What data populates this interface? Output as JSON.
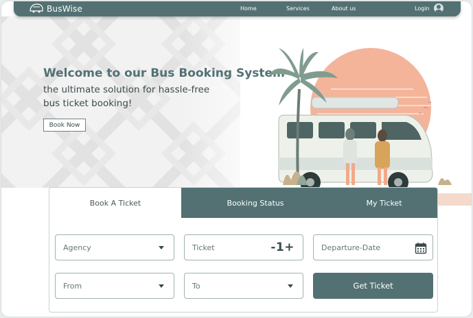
{
  "nav": {
    "brand": "BusWise",
    "links": [
      "Home",
      "Services",
      "About us"
    ],
    "login_label": "Login",
    "icons": {
      "logo": "bus-logo-icon",
      "user": "user-circle-icon"
    }
  },
  "hero": {
    "title": "Welcome to our Bus Booking System",
    "subtitle_line1": "the ultimate solution for hassle-free",
    "subtitle_line2": "bus ticket booking!",
    "cta_label": "Book Now"
  },
  "booking": {
    "tabs": [
      {
        "label": "Book A Ticket",
        "active": true
      },
      {
        "label": "Booking Status",
        "active": false
      },
      {
        "label": "My Ticket",
        "active": false
      }
    ],
    "fields": {
      "agency": "Agency",
      "ticket": "Ticket",
      "ticket_stepper": "-1+",
      "departure_date": "Departure-Date",
      "from": "From",
      "to": "To"
    },
    "submit_label": "Get Ticket"
  },
  "colors": {
    "primary": "#537173",
    "text_dark": "#3c4a4c",
    "sun": "#f4b49a",
    "background": "#ffffff"
  }
}
